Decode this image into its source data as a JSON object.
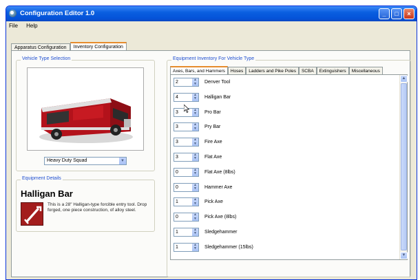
{
  "window": {
    "title": "Configuration Editor 1.0"
  },
  "menu": {
    "items": [
      {
        "label": "File"
      },
      {
        "label": "Help"
      }
    ]
  },
  "tabs": [
    {
      "label": "Apparatus Configuration",
      "active": false
    },
    {
      "label": "Inventory Configuration",
      "active": true
    }
  ],
  "vehicle_selection": {
    "title": "Vehicle Type Selection",
    "selected": "Heavy Duty Squad"
  },
  "equipment_details": {
    "title": "Equipment Details",
    "name": "Halligan Bar",
    "description": "This is a 28\" Halligan-type forcible entry tool. Drop forged, one piece construction, of alloy steel.",
    "icon": "halligan-bar-icon"
  },
  "inventory": {
    "title": "Equipment Inventory For Vehicle Type",
    "tabs": [
      {
        "label": "Axes, Bars, and Hammers",
        "active": true
      },
      {
        "label": "Hoses",
        "active": false
      },
      {
        "label": "Ladders and Pike Poles",
        "active": false
      },
      {
        "label": "SCBA",
        "active": false
      },
      {
        "label": "Extinguishers",
        "active": false
      },
      {
        "label": "Miscellaneous",
        "active": false
      }
    ],
    "items": [
      {
        "qty": "2",
        "name": "Denver Tool"
      },
      {
        "qty": "4",
        "name": "Halligan Bar"
      },
      {
        "qty": "3",
        "name": "Pro Bar"
      },
      {
        "qty": "3",
        "name": "Pry Bar"
      },
      {
        "qty": "3",
        "name": "Fire Axe"
      },
      {
        "qty": "3",
        "name": "Flat Axe"
      },
      {
        "qty": "0",
        "name": "Flat Axe (8lbs)"
      },
      {
        "qty": "0",
        "name": "Hammer Axe"
      },
      {
        "qty": "1",
        "name": "Pick Axe"
      },
      {
        "qty": "0",
        "name": "Pick Axe (8lbs)"
      },
      {
        "qty": "1",
        "name": "Sledgehammer"
      },
      {
        "qty": "1",
        "name": "Sledgehammer (15lbs)"
      }
    ]
  },
  "colors": {
    "titlebar": "#0453d8",
    "group_title": "#1f4fd0",
    "active_tab_accent": "#e68b2c",
    "truck_red": "#b3121b"
  }
}
